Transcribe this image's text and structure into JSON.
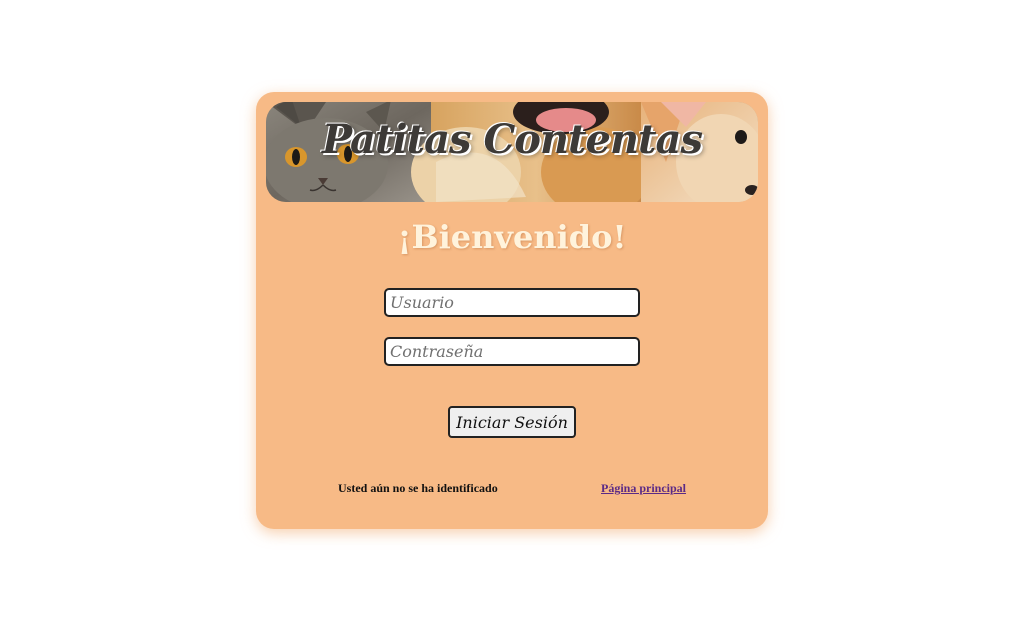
{
  "banner": {
    "title": "Patitas Contentas"
  },
  "login": {
    "heading": "¡Bienvenido!",
    "username_placeholder": "Usuario",
    "password_placeholder": "Contraseña",
    "submit_label": "Iniciar Sesión"
  },
  "footer": {
    "status_text": "Usted aún no se ha identificado",
    "home_link": "Página principal"
  },
  "colors": {
    "card_background": "#f7ba86",
    "heading_color": "#fff3dc",
    "link_color": "#5b2a86"
  }
}
